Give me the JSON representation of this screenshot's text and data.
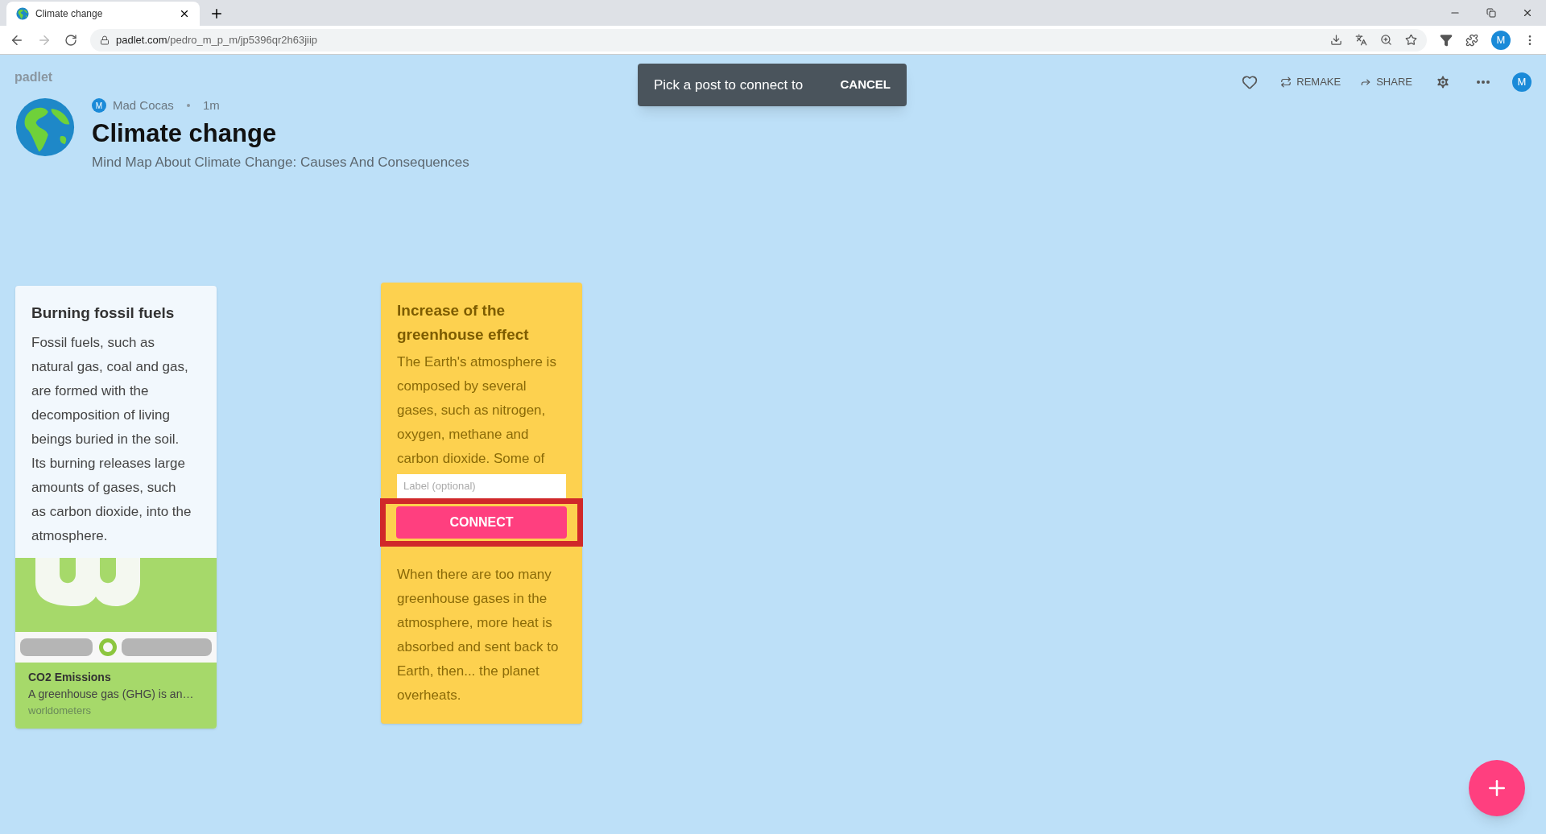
{
  "browser": {
    "tab_title": "Climate change",
    "url_host": "padlet.com",
    "url_path": "/pedro_m_p_m/jp5396qr2h63jiip",
    "profile_initial": "M"
  },
  "header": {
    "logo": "padlet",
    "author_initial": "M",
    "author": "Mad Cocas",
    "time": "1m",
    "title": "Climate change",
    "subtitle": "Mind Map About Climate Change: Causes And Consequences",
    "actions": [
      {
        "kind": "like"
      },
      {
        "kind": "text",
        "label": "REMAKE"
      },
      {
        "kind": "text",
        "label": "SHARE"
      },
      {
        "kind": "settings"
      },
      {
        "kind": "more"
      },
      {
        "kind": "avatar",
        "label": "M"
      }
    ]
  },
  "toast": {
    "message": "Pick a post to connect to",
    "action": "CANCEL"
  },
  "posts": [
    {
      "kind": "link",
      "title": "Burning fossil fuels",
      "body": "Fossil fuels, such as natural gas, coal and gas, are formed with the decomposition of living beings buried in the soil. Its burning releases large amounts of gases, such as carbon dioxide, into the atmosphere.",
      "attachment": {
        "title": "CO2 Emissions",
        "description": "A greenhouse gas (GHG) is an…",
        "source": "worldometers"
      }
    },
    {
      "kind": "connect",
      "title": "Increase of the greenhouse effect",
      "body_top": "The Earth's atmosphere is composed by several gases, such as nitrogen, oxygen, methane and carbon dioxide. Some of",
      "label_placeholder": "Label (optional)",
      "button": "CONNECT",
      "body_bottom": "When there are too many greenhouse gases in the atmosphere, more heat is absorbed and sent back to Earth, then... the planet overheats."
    }
  ]
}
